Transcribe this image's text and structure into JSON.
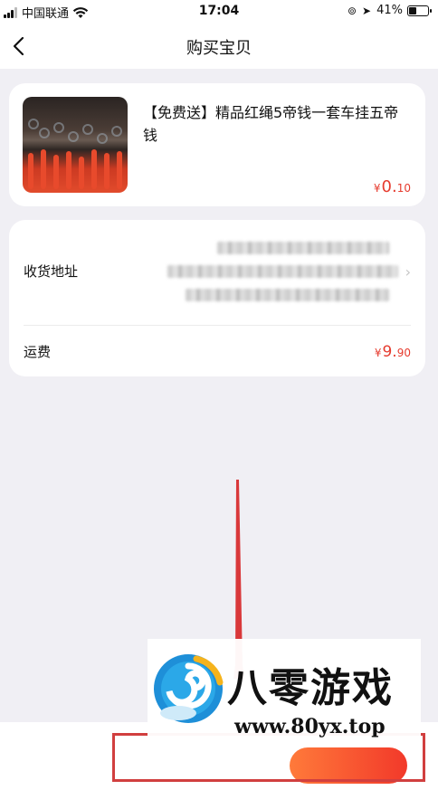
{
  "status_bar": {
    "carrier": "中国联通",
    "time": "17:04",
    "battery_percent": "41%",
    "battery_level": 0.41,
    "icons": [
      "signal-icon",
      "wifi-icon",
      "rotation-lock-icon",
      "location-icon",
      "battery-icon"
    ]
  },
  "nav": {
    "title": "购买宝贝",
    "back_icon": "chevron-left-icon"
  },
  "product": {
    "title": "【免费送】精品红绳5帝钱一套车挂五帝钱",
    "price_currency": "¥",
    "price_main": "0.",
    "price_decimal": "10"
  },
  "address": {
    "label": "收货地址",
    "chevron": "chevron-right-icon"
  },
  "shipping": {
    "label": "运费",
    "price_currency": "¥",
    "price_main": "9.",
    "price_decimal": "90"
  },
  "watermark": {
    "name": "八零游戏",
    "url": "www.80yx.top"
  },
  "colors": {
    "accent": "#e63b2e",
    "background": "#f0eff4",
    "card": "#ffffff",
    "highlight": "#d13f3f"
  }
}
